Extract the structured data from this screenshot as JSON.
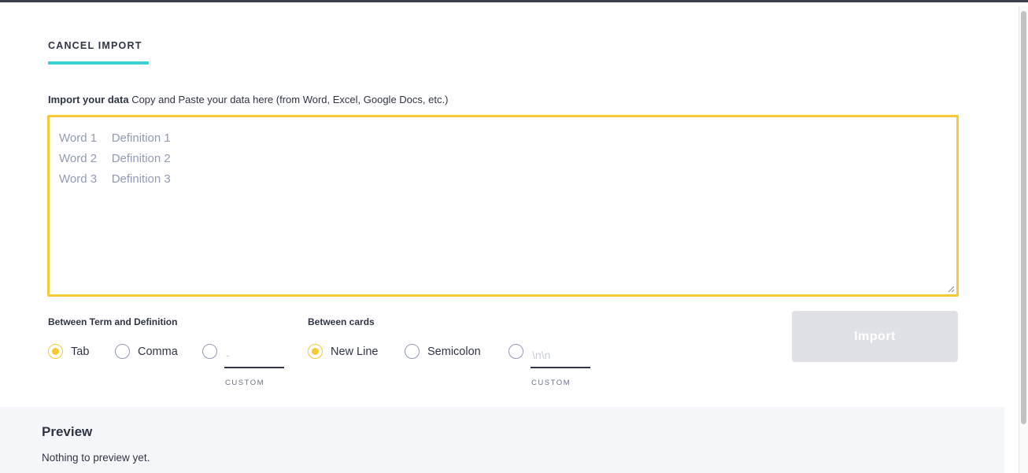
{
  "header": {
    "cancel_label": "CANCEL IMPORT"
  },
  "import": {
    "label_bold": "Import your data",
    "label_rest": " Copy and Paste your data here (from Word, Excel, Google Docs, etc.)",
    "placeholder": "Word 1\tDefinition 1\nWord 2\tDefinition 2\nWord 3\tDefinition 3",
    "button_label": "Import"
  },
  "term_definition": {
    "label": "Between Term and Definition",
    "options": [
      {
        "label": "Tab",
        "checked": true
      },
      {
        "label": "Comma",
        "checked": false
      },
      {
        "label": "",
        "checked": false
      }
    ],
    "custom_placeholder": "-",
    "custom_label": "CUSTOM"
  },
  "between_cards": {
    "label": "Between cards",
    "options": [
      {
        "label": "New Line",
        "checked": true
      },
      {
        "label": "Semicolon",
        "checked": false
      },
      {
        "label": "",
        "checked": false
      }
    ],
    "custom_placeholder": "\\n\\n",
    "custom_label": "CUSTOM"
  },
  "preview": {
    "title": "Preview",
    "empty_text": "Nothing to preview yet."
  },
  "colors": {
    "accent_yellow": "#f7c934",
    "accent_teal": "#3ccfcf",
    "text_dark": "#303545",
    "button_disabled": "#dfe1e6",
    "preview_bg": "#f6f7fb"
  }
}
